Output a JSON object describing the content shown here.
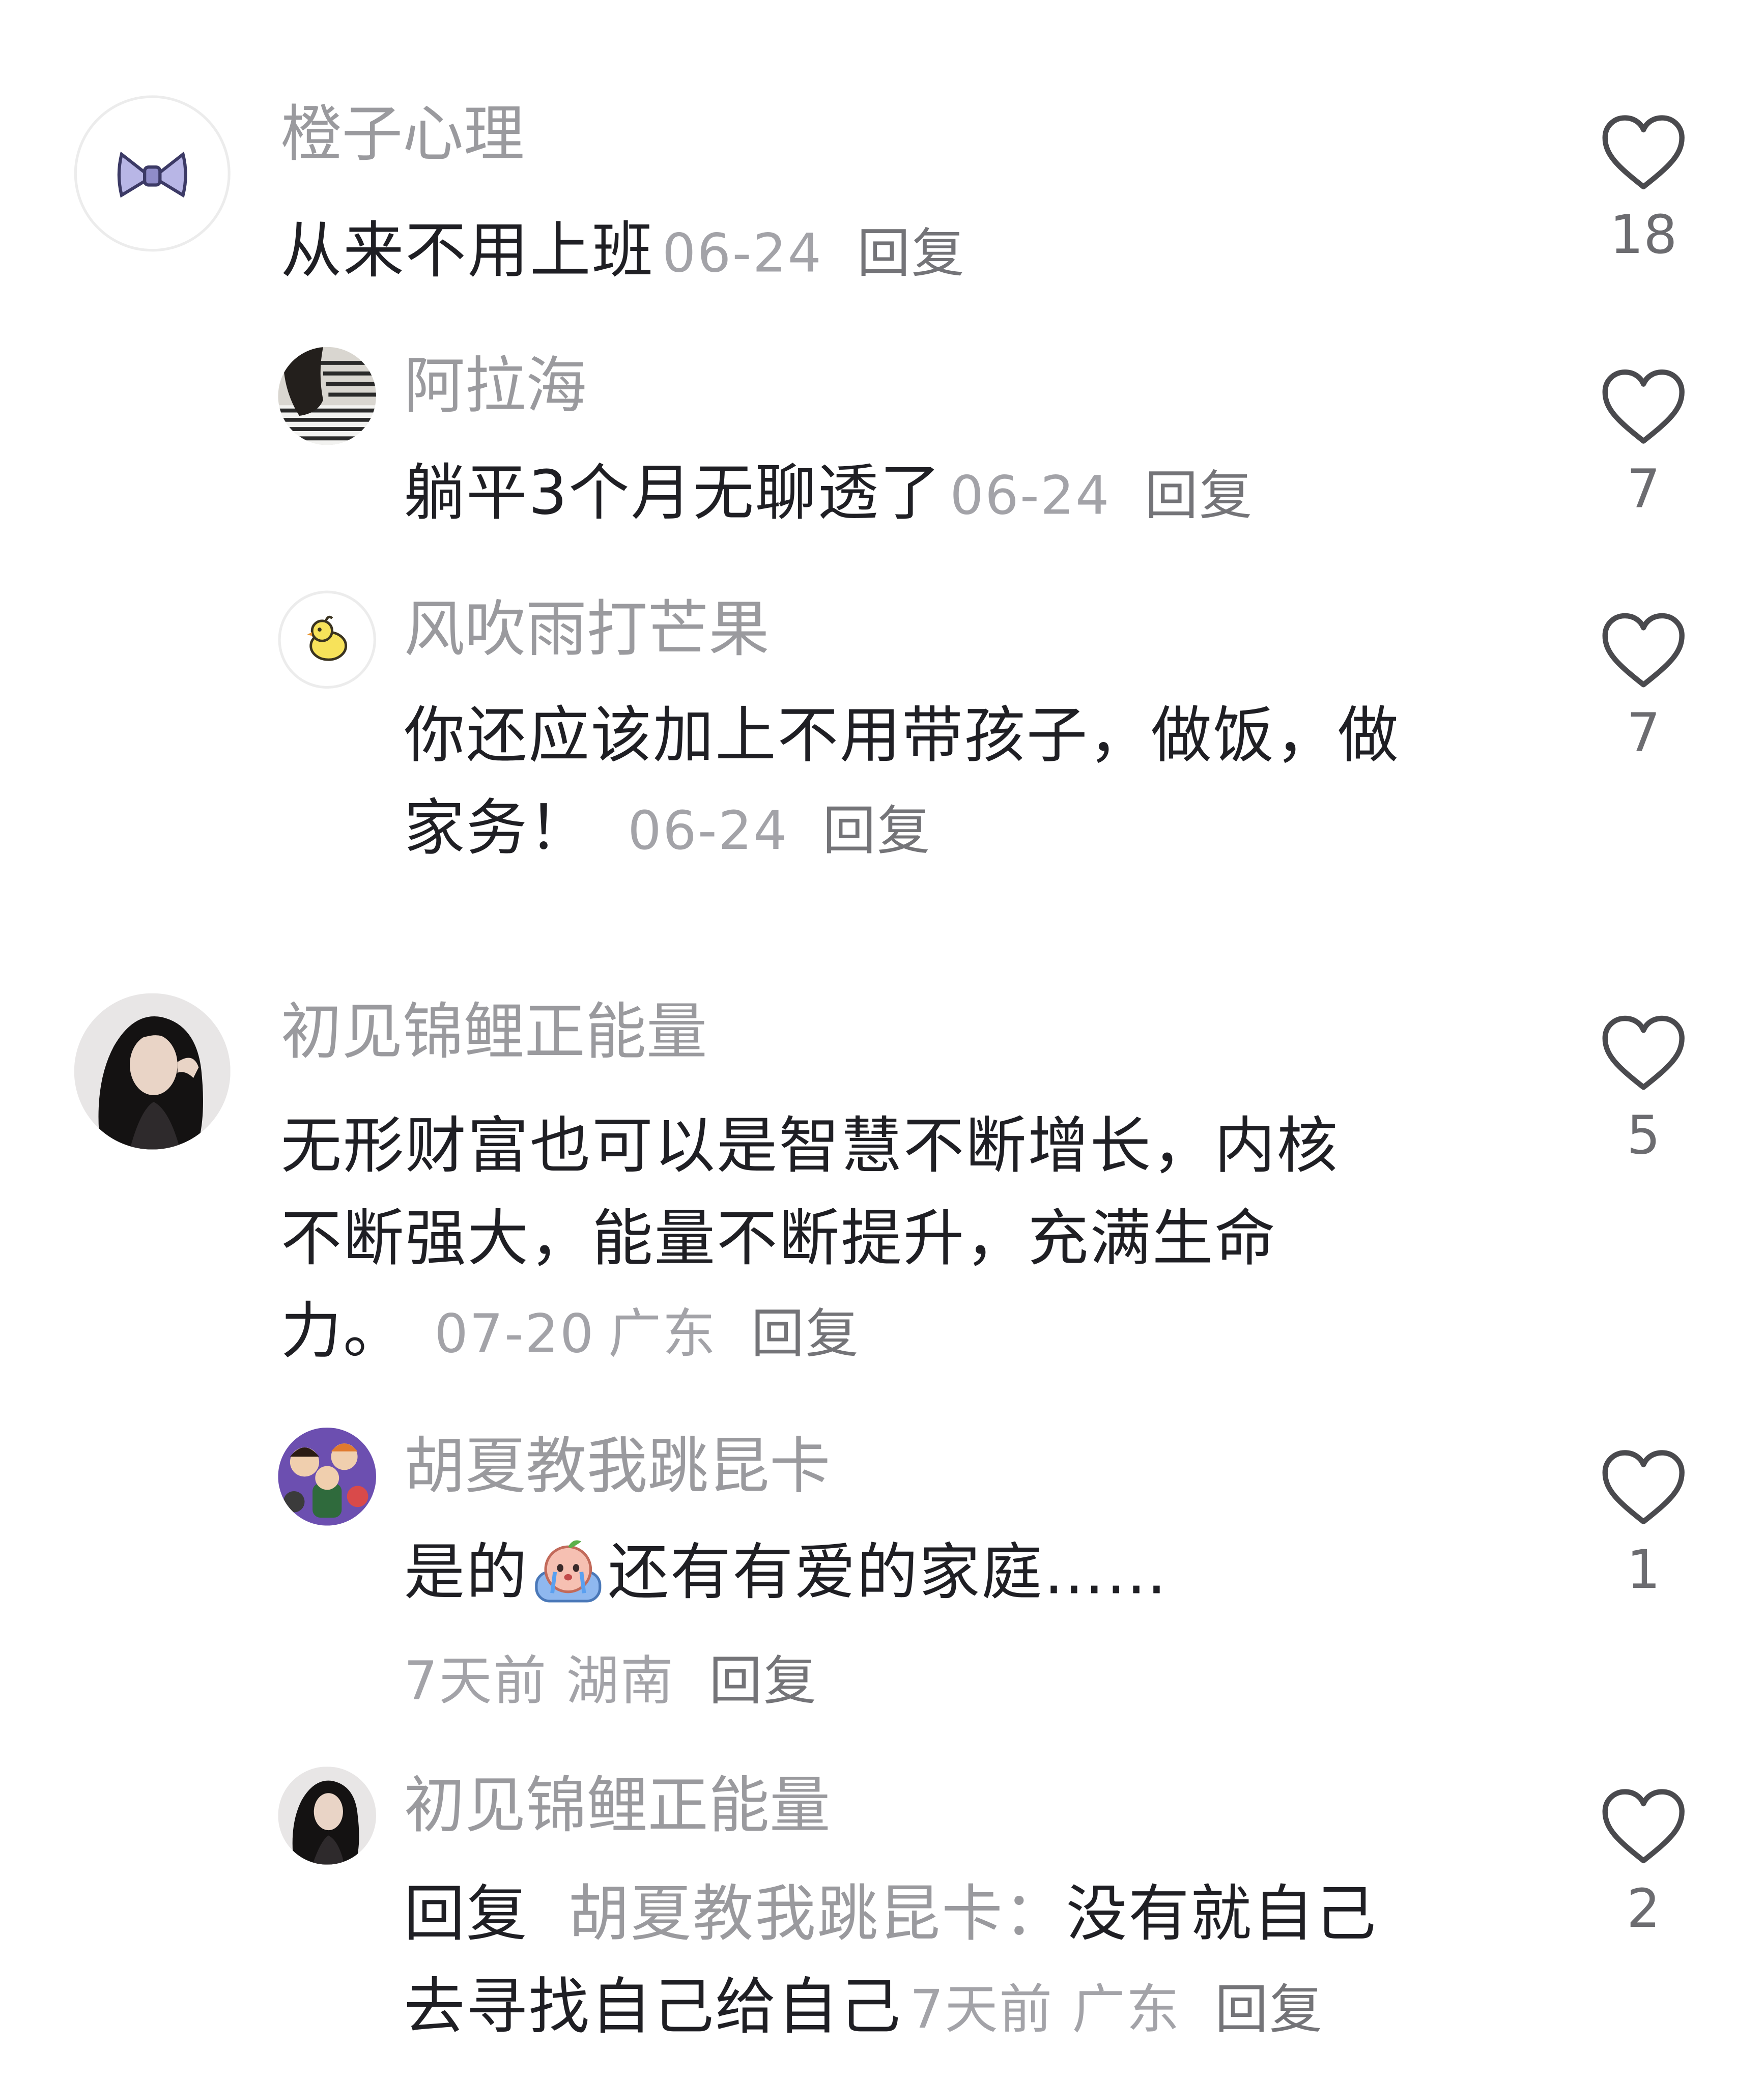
{
  "comments": [
    {
      "username": "橙子心理",
      "text": "从来不用上班",
      "date": "06-24",
      "reply_label": "回复",
      "likes": "18",
      "avatar_icon": "bow-icon",
      "replies": [
        {
          "username": "阿拉海",
          "text": "躺平3个月无聊透了",
          "date": "06-24",
          "reply_label": "回复",
          "likes": "7",
          "avatar_icon": "person-striped-shirt-avatar"
        },
        {
          "username": "风吹雨打芒果",
          "text_line1": "你还应该加上不用带孩子，做饭，做",
          "text_line2": "家务！",
          "date": "06-24",
          "reply_label": "回复",
          "likes": "7",
          "avatar_icon": "chick-icon"
        }
      ]
    },
    {
      "username": "初见锦鲤正能量",
      "text_line1": "无形财富也可以是智慧不断增长，内核",
      "text_line2": "不断强大，能量不断提升，充满生命",
      "text_line3": "力。",
      "date": "07-20",
      "location": "广东",
      "reply_label": "回复",
      "likes": "5",
      "avatar_icon": "woman-portrait-avatar",
      "replies": [
        {
          "username": "胡夏教我跳昆卡",
          "text_before_emoji": "是的",
          "emoji_icon": "crying-peach-emoji",
          "text_after_emoji": "还有有爱的家庭……",
          "date": "7天前",
          "location": "湖南",
          "reply_label": "回复",
          "likes": "1",
          "avatar_icon": "cartoon-group-avatar"
        },
        {
          "username": "初见锦鲤正能量",
          "reply_prefix": "回复",
          "reply_to": "胡夏教我跳昆卡：",
          "text_line1": "没有就自己",
          "text_line2": "去寻找自己给自己",
          "date": "7天前",
          "location": "广东",
          "reply_label": "回复",
          "likes": "2",
          "avatar_icon": "woman-portrait-avatar"
        }
      ]
    }
  ],
  "colors": {
    "username": "#9a9a9e",
    "body_text": "#1f1f24",
    "meta": "#a3a3a8",
    "like_icon": "#4a4a4e"
  }
}
